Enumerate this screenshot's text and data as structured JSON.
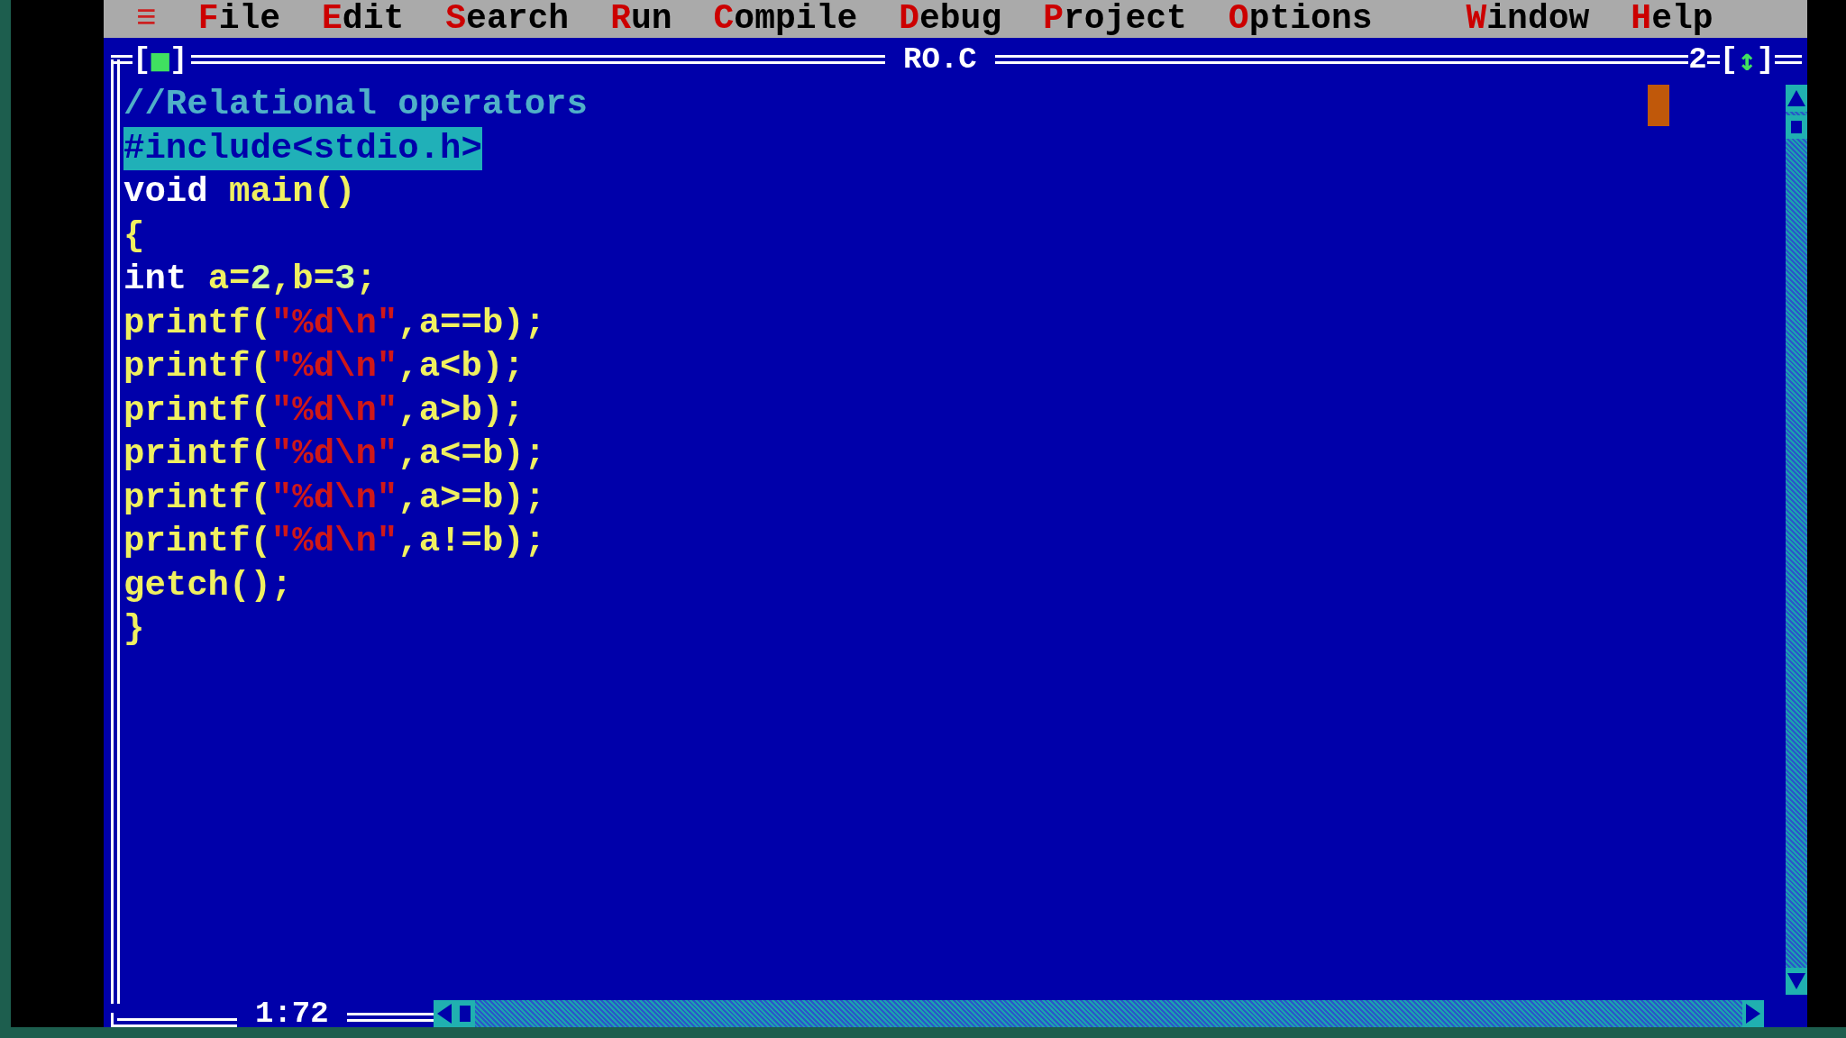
{
  "menu": {
    "system": "≡",
    "items": [
      {
        "label": "File"
      },
      {
        "label": "Edit"
      },
      {
        "label": "Search"
      },
      {
        "label": "Run"
      },
      {
        "label": "Compile"
      },
      {
        "label": "Debug"
      },
      {
        "label": "Project"
      },
      {
        "label": "Options"
      },
      {
        "label": "Window"
      },
      {
        "label": "Help"
      }
    ]
  },
  "window": {
    "close_box": {
      "open": "[",
      "mark": "■",
      "close": "]"
    },
    "title": "RO.C",
    "number": "2",
    "zoom_box": {
      "open": "[",
      "mark": "↕",
      "close": "]"
    },
    "position": "1:72"
  },
  "code": [
    {
      "selected": false,
      "tokens": [
        {
          "kind": "comment",
          "text": "//Relational operators"
        }
      ]
    },
    {
      "selected": true,
      "tokens": [
        {
          "kind": "preproc",
          "text": "#include<stdio.h>"
        }
      ]
    },
    {
      "selected": false,
      "tokens": [
        {
          "kind": "keyword",
          "text": "void "
        },
        {
          "kind": "ident",
          "text": "main()"
        }
      ]
    },
    {
      "selected": false,
      "tokens": [
        {
          "kind": "ident",
          "text": "{"
        }
      ]
    },
    {
      "selected": false,
      "tokens": [
        {
          "kind": "keyword",
          "text": "int "
        },
        {
          "kind": "ident",
          "text": "a="
        },
        {
          "kind": "number",
          "text": "2"
        },
        {
          "kind": "ident",
          "text": ",b="
        },
        {
          "kind": "number",
          "text": "3"
        },
        {
          "kind": "ident",
          "text": ";"
        }
      ]
    },
    {
      "selected": false,
      "tokens": [
        {
          "kind": "ident",
          "text": "printf("
        },
        {
          "kind": "string",
          "text": "\"%d\\n\""
        },
        {
          "kind": "ident",
          "text": ",a==b);"
        }
      ]
    },
    {
      "selected": false,
      "tokens": [
        {
          "kind": "ident",
          "text": "printf("
        },
        {
          "kind": "string",
          "text": "\"%d\\n\""
        },
        {
          "kind": "ident",
          "text": ",a<b);"
        }
      ]
    },
    {
      "selected": false,
      "tokens": [
        {
          "kind": "ident",
          "text": "printf("
        },
        {
          "kind": "string",
          "text": "\"%d\\n\""
        },
        {
          "kind": "ident",
          "text": ",a>b);"
        }
      ]
    },
    {
      "selected": false,
      "tokens": [
        {
          "kind": "ident",
          "text": "printf("
        },
        {
          "kind": "string",
          "text": "\"%d\\n\""
        },
        {
          "kind": "ident",
          "text": ",a<=b);"
        }
      ]
    },
    {
      "selected": false,
      "tokens": [
        {
          "kind": "ident",
          "text": "printf("
        },
        {
          "kind": "string",
          "text": "\"%d\\n\""
        },
        {
          "kind": "ident",
          "text": ",a>=b);"
        }
      ]
    },
    {
      "selected": false,
      "tokens": [
        {
          "kind": "ident",
          "text": "printf("
        },
        {
          "kind": "string",
          "text": "\"%d\\n\""
        },
        {
          "kind": "ident",
          "text": ",a!=b);"
        }
      ]
    },
    {
      "selected": false,
      "tokens": [
        {
          "kind": "ident",
          "text": "getch();"
        }
      ]
    },
    {
      "selected": false,
      "tokens": [
        {
          "kind": "ident",
          "text": "}"
        }
      ]
    }
  ]
}
